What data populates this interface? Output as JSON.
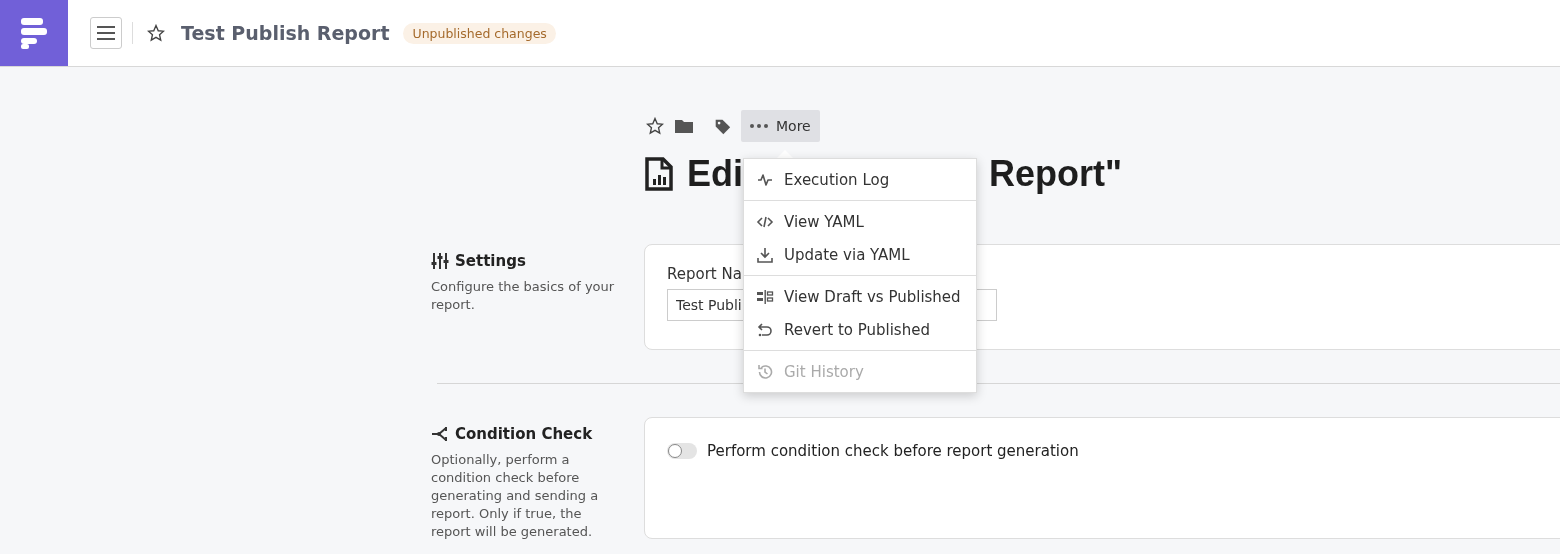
{
  "header": {
    "title": "Test Publish Report",
    "badge": "Unpublished changes",
    "starred": false
  },
  "toolbar": {
    "more_label": "More"
  },
  "heading": {
    "visible_start": "Edi",
    "visible_end": "Report\""
  },
  "menu": {
    "groups": [
      [
        {
          "label": "Execution Log",
          "disabled": false
        }
      ],
      [
        {
          "label": "View YAML",
          "disabled": false
        },
        {
          "label": "Update via YAML",
          "disabled": false
        }
      ],
      [
        {
          "label": "View Draft vs Published",
          "disabled": false
        },
        {
          "label": "Revert to Published",
          "disabled": false
        }
      ],
      [
        {
          "label": "Git History",
          "disabled": true
        }
      ]
    ]
  },
  "sections": [
    {
      "kind": "settings",
      "title": "Settings",
      "description": "Configure the basics of your report.",
      "field_label": "Report Na",
      "field_value": "Test Publi"
    },
    {
      "kind": "condition",
      "title": "Condition Check",
      "description": "Optionally, perform a condition check before generating and sending a report. Only if true, the report will be generated.",
      "toggle": {
        "label": "Perform condition check before report generation",
        "on": false
      }
    }
  ]
}
